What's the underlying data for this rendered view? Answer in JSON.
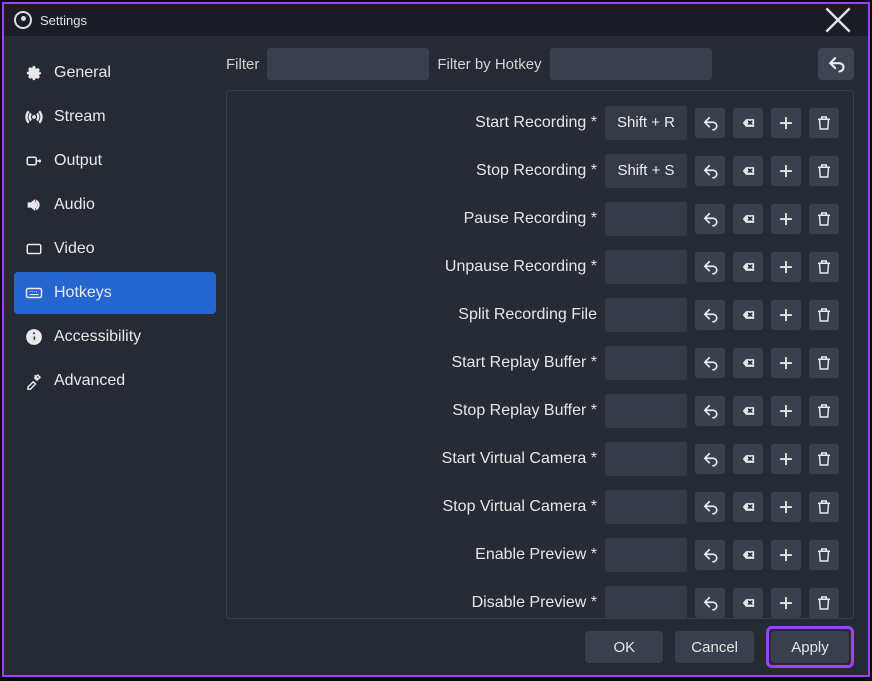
{
  "window": {
    "title": "Settings"
  },
  "sidebar": {
    "items": [
      {
        "label": "General",
        "icon": "gear"
      },
      {
        "label": "Stream",
        "icon": "broadcast"
      },
      {
        "label": "Output",
        "icon": "output"
      },
      {
        "label": "Audio",
        "icon": "audio"
      },
      {
        "label": "Video",
        "icon": "video"
      },
      {
        "label": "Hotkeys",
        "icon": "keyboard",
        "active": true
      },
      {
        "label": "Accessibility",
        "icon": "accessibility"
      },
      {
        "label": "Advanced",
        "icon": "tools"
      }
    ]
  },
  "filter": {
    "label": "Filter",
    "hotkey_label": "Filter by Hotkey",
    "value": "",
    "hotkey_value": ""
  },
  "hotkeys": [
    {
      "label": "Start Recording *",
      "value": "Shift + R"
    },
    {
      "label": "Stop Recording *",
      "value": "Shift + S"
    },
    {
      "label": "Pause Recording *",
      "value": ""
    },
    {
      "label": "Unpause Recording *",
      "value": ""
    },
    {
      "label": "Split Recording File",
      "value": ""
    },
    {
      "label": "Start Replay Buffer *",
      "value": ""
    },
    {
      "label": "Stop Replay Buffer *",
      "value": ""
    },
    {
      "label": "Start Virtual Camera *",
      "value": ""
    },
    {
      "label": "Stop Virtual Camera *",
      "value": ""
    },
    {
      "label": "Enable Preview *",
      "value": ""
    },
    {
      "label": "Disable Preview *",
      "value": ""
    }
  ],
  "footer": {
    "ok": "OK",
    "cancel": "Cancel",
    "apply": "Apply"
  }
}
